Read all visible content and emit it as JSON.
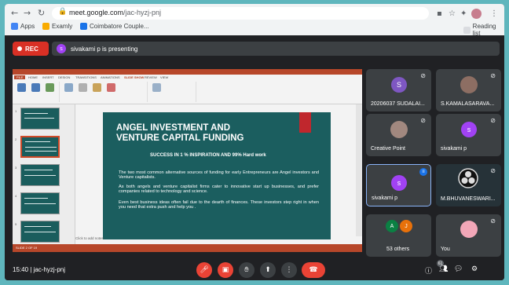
{
  "browser": {
    "url_domain": "meet.google.com",
    "url_path": "/jac-hyzj-pnj",
    "bookmarks": [
      {
        "label": "Apps",
        "color": "#4285f4"
      },
      {
        "label": "Examly",
        "color": "#f9ab00"
      },
      {
        "label": "Coimbatore Couple...",
        "color": "#1a73e8"
      }
    ],
    "reading_list": "Reading list"
  },
  "meet": {
    "rec_label": "REC",
    "presenter_initial": "s",
    "presenter_text": "sivakami p is presenting",
    "meeting_time": "15:40",
    "meeting_code": "jac-hyzj-pnj",
    "people_count": "61"
  },
  "powerpoint": {
    "tabs": [
      "FILE",
      "HOME",
      "INSERT",
      "DESIGN",
      "TRANSITIONS",
      "ANIMATIONS",
      "SLIDE SHOW",
      "REVIEW",
      "VIEW"
    ],
    "active_tab": "SLIDE SHOW",
    "slide_numbers": [
      "1",
      "2",
      "3",
      "4",
      "5"
    ],
    "notes_placeholder": "Click to add notes",
    "status_text": "SLIDE 2 OF 19"
  },
  "slide": {
    "title_line1": "ANGEL INVESTMENT AND",
    "title_line2": "VENTURE CAPITAL FUNDING",
    "subtitle": "SUCCESS IN 1 % INSPIRATION AND 99% Hard work",
    "para1": "The two most common alternative sources of funding for early Entrepreneurs are Angel investors and Venture capitalists.",
    "para2": "As both angels and venture capitalist firms cater to innovative start up businesses, and prefer companies related to technology and science.",
    "para3": "Even best business ideas often fail due to the dearth of finances. These investors step right in when you need that extra push and help you ."
  },
  "participants": [
    {
      "name": "20206037 SUDALAI...",
      "initial": "S",
      "color": "#7e57c2",
      "muted": true
    },
    {
      "name": "S.KAMALASARAVA...",
      "photo": true,
      "muted": true
    },
    {
      "name": "Creative Point",
      "photo": true,
      "muted": true
    },
    {
      "name": "sivakami p",
      "initial": "s",
      "color": "#a142f4",
      "muted": true
    },
    {
      "name": "sivakami p",
      "initial": "s",
      "color": "#a142f4",
      "speaking": true
    },
    {
      "name": "M.BHUVANESWARI...",
      "photo": true,
      "muted": true
    },
    {
      "name": "53 others",
      "initials": [
        "A",
        "J"
      ]
    },
    {
      "name": "You",
      "photo": true,
      "muted": true
    }
  ]
}
